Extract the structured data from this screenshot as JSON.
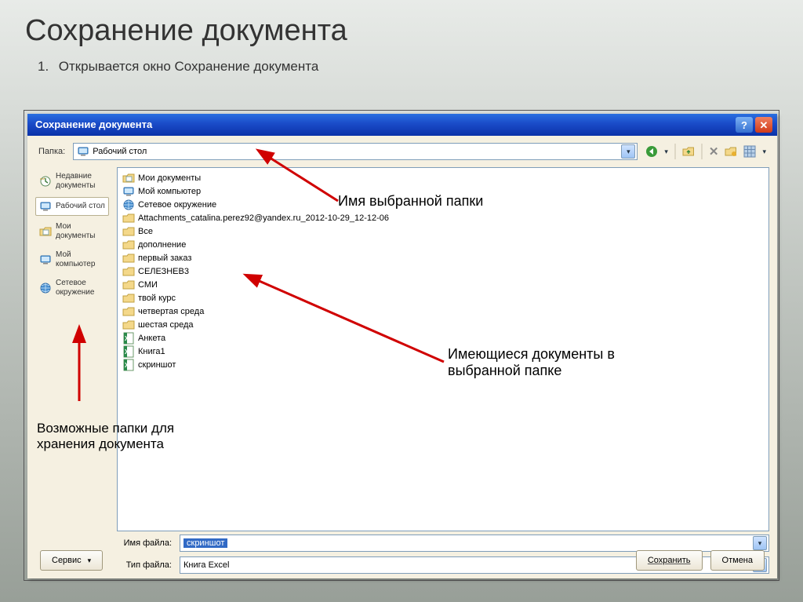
{
  "slide": {
    "title": "Сохранение документа",
    "list_number": "1.",
    "list_item": "Открывается окно Сохранение документа"
  },
  "dialog": {
    "title": "Сохранение документа",
    "folder_label": "Папка:",
    "current_folder": "Рабочий стол",
    "filename_label": "Имя файла:",
    "filename_value": "скриншот",
    "filetype_label": "Тип файла:",
    "filetype_value": "Книга Excel",
    "service_button": "Сервис",
    "save_button": "Сохранить",
    "cancel_button": "Отмена"
  },
  "places": [
    {
      "label": "Недавние документы",
      "icon": "recent"
    },
    {
      "label": "Рабочий стол",
      "icon": "desktop",
      "selected": true
    },
    {
      "label": "Мои документы",
      "icon": "mydocs"
    },
    {
      "label": "Мой компьютер",
      "icon": "computer"
    },
    {
      "label": "Сетевое окружение",
      "icon": "network"
    }
  ],
  "files": [
    {
      "label": "Мои документы",
      "icon": "mydocs"
    },
    {
      "label": "Мой компьютер",
      "icon": "computer"
    },
    {
      "label": "Сетевое окружение",
      "icon": "network"
    },
    {
      "label": "Attachments_catalina.perez92@yandex.ru_2012-10-29_12-12-06",
      "icon": "folder"
    },
    {
      "label": "Все",
      "icon": "folder"
    },
    {
      "label": "дополнение",
      "icon": "folder"
    },
    {
      "label": "первый заказ",
      "icon": "folder"
    },
    {
      "label": "СЕЛЕЗНЕВ3",
      "icon": "folder"
    },
    {
      "label": "СМИ",
      "icon": "folder"
    },
    {
      "label": "твой курс",
      "icon": "folder"
    },
    {
      "label": "четвертая среда",
      "icon": "folder"
    },
    {
      "label": "шестая среда",
      "icon": "folder"
    },
    {
      "label": "Анкета",
      "icon": "excel"
    },
    {
      "label": "Книга1",
      "icon": "excel"
    },
    {
      "label": "скриншот",
      "icon": "excel"
    }
  ],
  "annotations": {
    "a1": "Имя выбранной папки",
    "a2_line1": "Имеющиеся документы в",
    "a2_line2": "выбранной папке",
    "a3_line1": "Возможные папки для",
    "a3_line2": "хранения документа"
  }
}
